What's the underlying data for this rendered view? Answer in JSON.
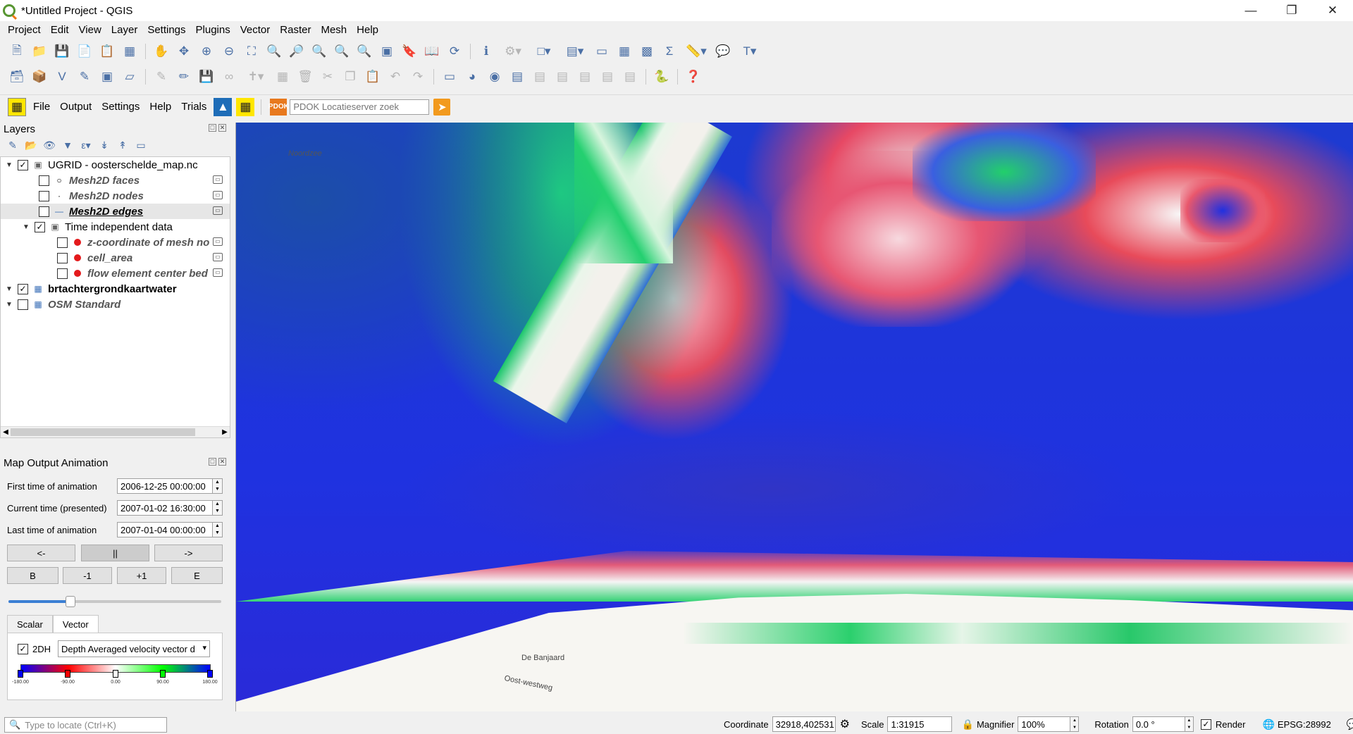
{
  "window": {
    "title": "*Untitled Project - QGIS",
    "min_icon": "minimize-icon",
    "max_icon": "restore-icon",
    "close_icon": "close-icon"
  },
  "menu": [
    "Project",
    "Edit",
    "View",
    "Layer",
    "Settings",
    "Plugins",
    "Vector",
    "Raster",
    "Mesh",
    "Help"
  ],
  "plugin_toolbar": {
    "items": [
      "File",
      "Output",
      "Settings",
      "Help",
      "Trials"
    ],
    "pdok_placeholder": "PDOK Locatieserver zoek",
    "pdok_logo_text": "PDOK"
  },
  "layers_panel": {
    "title": "Layers",
    "layers": [
      {
        "label": "UGRID - oosterschelde_map.nc",
        "checked": true,
        "expanded": true
      },
      {
        "label": "Mesh2D faces",
        "checked": false
      },
      {
        "label": "Mesh2D nodes",
        "checked": false
      },
      {
        "label": "Mesh2D edges",
        "checked": false
      },
      {
        "label": "Time independent data",
        "checked": true,
        "expanded": true
      },
      {
        "label": "z-coordinate of mesh no",
        "checked": false
      },
      {
        "label": "cell_area",
        "checked": false
      },
      {
        "label": "flow element center bed",
        "checked": false
      },
      {
        "label": "brtachtergrondkaartwater",
        "checked": true
      },
      {
        "label": "OSM Standard",
        "checked": false
      }
    ]
  },
  "animation_panel": {
    "title": "Map Output Animation",
    "first_label": "First time of animation",
    "first_value": "2006-12-25 00:00:00",
    "current_label": "Current time (presented)",
    "current_value": "2007-01-02 16:30:00",
    "last_label": "Last time of animation",
    "last_value": "2007-01-04 00:00:00",
    "btn_prev": "<-",
    "btn_pause": "||",
    "btn_next": "->",
    "btn_begin": "B",
    "btn_minus": "-1",
    "btn_plus": "+1",
    "btn_end": "E",
    "slider_fraction": 0.29,
    "tabs": [
      "Scalar",
      "Vector"
    ],
    "active_tab": "Vector",
    "vector_check_label": "2DH",
    "vector_select": "Depth Averaged velocity vector d",
    "ramp_labels": [
      "-180.00",
      "-90.00",
      "0.00",
      "90.00",
      "180.00"
    ],
    "ramp_colors": [
      "#0000ff",
      "#ff0000",
      "#ffffff",
      "#00ff00",
      "#0000ff"
    ]
  },
  "locator": {
    "placeholder": "Type to locate (Ctrl+K)"
  },
  "map": {
    "labels": [
      "Noordzee",
      "De Banjaard",
      "Oost-westweg"
    ]
  },
  "statusbar": {
    "coordinate_label": "Coordinate",
    "coordinate_value": "32918,402531",
    "scale_label": "Scale",
    "scale_value": "1:31915",
    "magnifier_label": "Magnifier",
    "magnifier_value": "100%",
    "rotation_label": "Rotation",
    "rotation_value": "0.0 °",
    "render_label": "Render",
    "crs": "EPSG:28992"
  }
}
